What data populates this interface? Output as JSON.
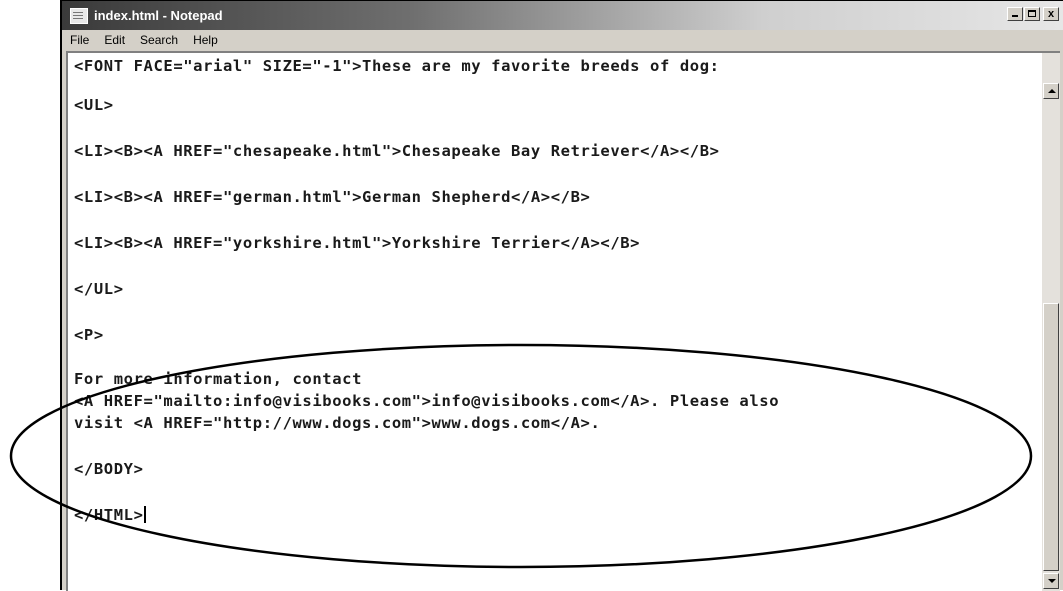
{
  "window": {
    "title": "index.html - Notepad",
    "buttons": {
      "minimize": "",
      "maximize": "",
      "close": "x"
    }
  },
  "menu": [
    "File",
    "Edit",
    "Search",
    "Help"
  ],
  "document": {
    "lines": [
      "<FONT FACE=\"arial\" SIZE=\"-1\">These are my favorite breeds of dog:",
      "<UL>",
      "<LI><B><A HREF=\"chesapeake.html\">Chesapeake Bay Retriever</A></B>",
      "<LI><B><A HREF=\"german.html\">German Shepherd</A></B>",
      "<LI><B><A HREF=\"yorkshire.html\">Yorkshire Terrier</A></B>",
      "</UL>",
      "<P>",
      "For more information, contact",
      "<A HREF=\"mailto:info@visibooks.com\">info@visibooks.com</A>. Please also",
      "visit <A HREF=\"http://www.dogs.com\">www.dogs.com</A>.",
      "</BODY>",
      "</HTML>"
    ]
  },
  "annotation": {
    "shape": "ellipse",
    "color": "#000000"
  }
}
